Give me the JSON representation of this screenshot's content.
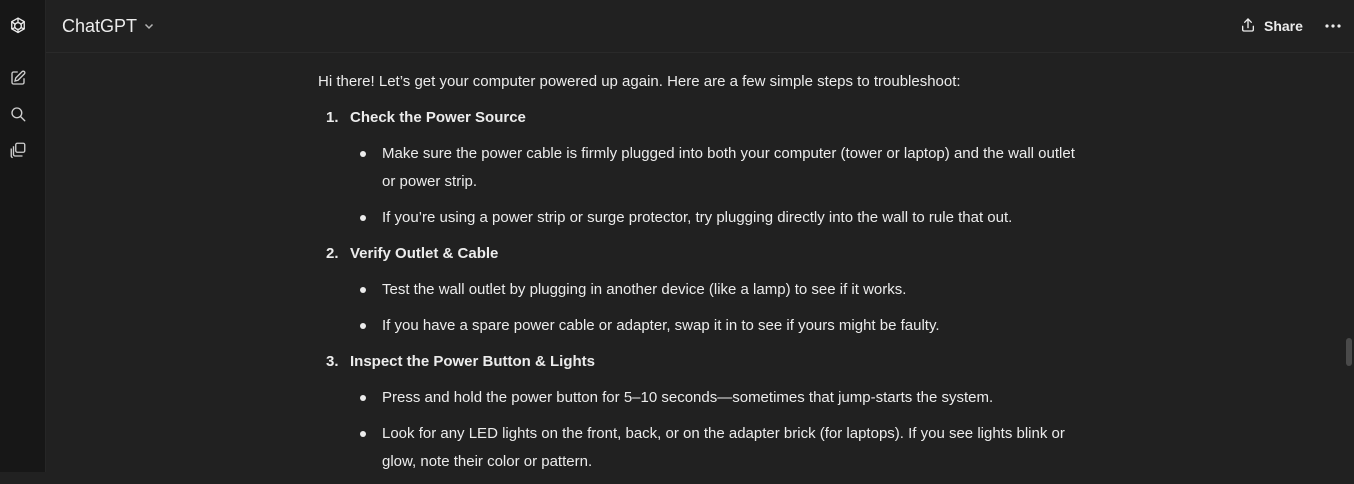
{
  "sidebar": {
    "icons": [
      "openai-logo-icon",
      "new-chat-icon",
      "search-icon",
      "library-icon"
    ]
  },
  "header": {
    "model_label": "ChatGPT",
    "share_label": "Share"
  },
  "message": {
    "intro": "Hi there! Let’s get your computer powered up again. Here are a few simple steps to troubleshoot:",
    "steps": [
      {
        "number": "1.",
        "title": "Check the Power Source",
        "bullets": [
          "Make sure the power cable is firmly plugged into both your computer (tower or laptop) and the wall outlet or power strip.",
          "If you’re using a power strip or surge protector, try plugging directly into the wall to rule that out."
        ]
      },
      {
        "number": "2.",
        "title": "Verify Outlet & Cable",
        "bullets": [
          "Test the wall outlet by plugging in another device (like a lamp) to see if it works.",
          "If you have a spare power cable or adapter, swap it in to see if yours might be faulty."
        ]
      },
      {
        "number": "3.",
        "title": "Inspect the Power Button & Lights",
        "bullets": [
          "Press and hold the power button for 5–10 seconds—sometimes that jump-starts the system.",
          "Look for any LED lights on the front, back, or on the adapter brick (for laptops). If you see lights blink or glow, note their color or pattern."
        ]
      }
    ]
  }
}
